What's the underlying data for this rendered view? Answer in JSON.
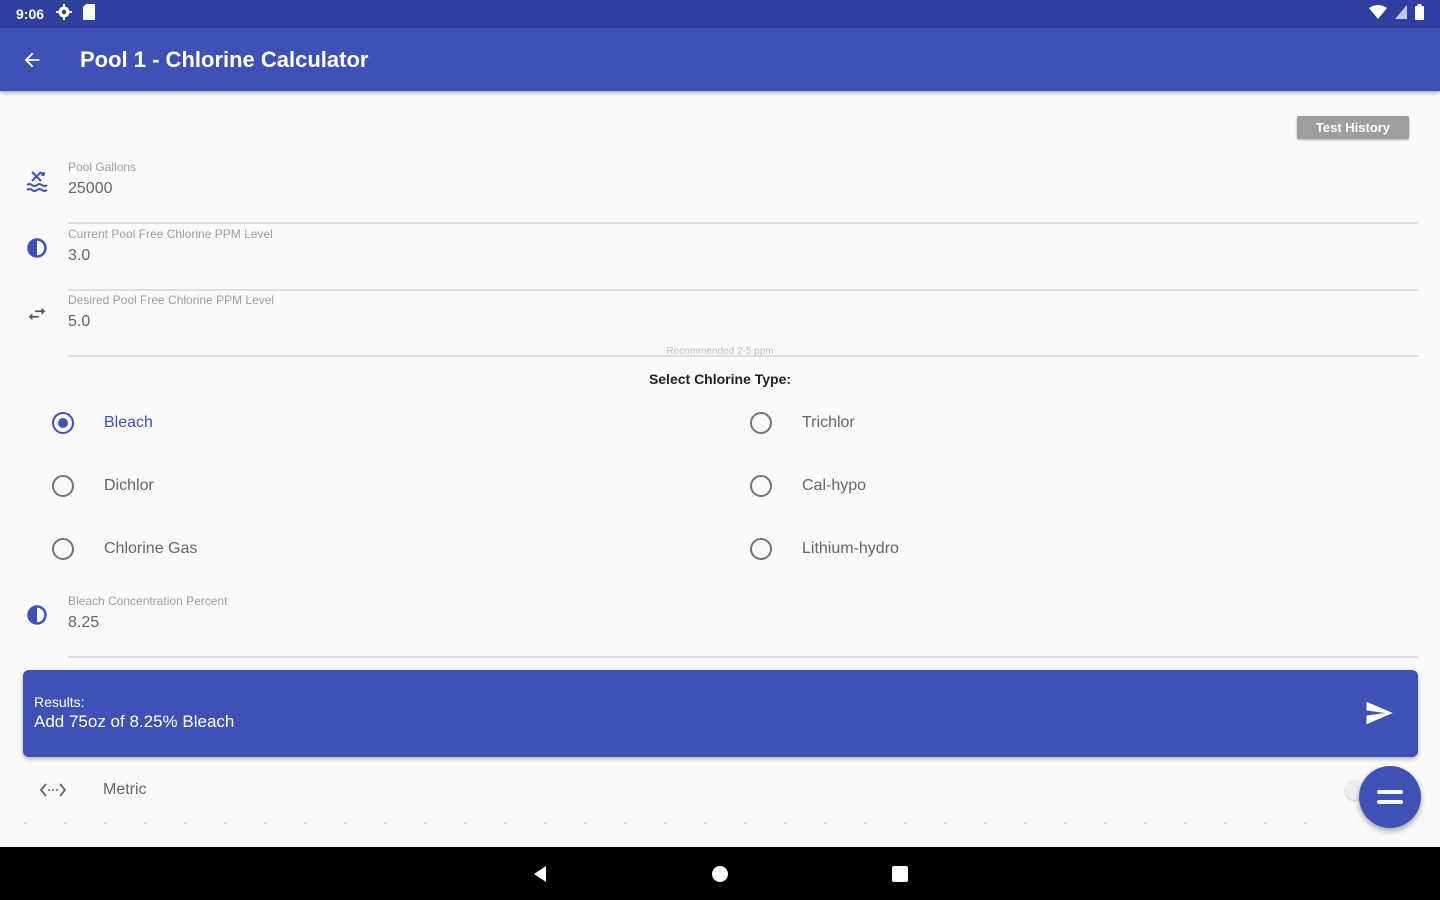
{
  "status_bar": {
    "time": "9:06"
  },
  "app_bar": {
    "title": "Pool 1 - Chlorine Calculator"
  },
  "test_history_label": "Test History",
  "fields": {
    "pool_gallons": {
      "label": "Pool Gallons",
      "value": "25000"
    },
    "current_ppm": {
      "label": "Current Pool Free Chlorine PPM Level",
      "value": "3.0"
    },
    "desired_ppm": {
      "label": "Desired Pool Free Chlorine PPM Level",
      "value": "5.0"
    },
    "bleach_percent": {
      "label": "Bleach Concentration Percent",
      "value": "8.25"
    }
  },
  "recommended_hint": "Recommended 2-5 ppm",
  "select_type_title": "Select Chlorine Type:",
  "chlorine_types": {
    "bleach": {
      "label": "Bleach",
      "checked": true
    },
    "trichlor": {
      "label": "Trichlor",
      "checked": false
    },
    "dichlor": {
      "label": "Dichlor",
      "checked": false
    },
    "cal_hypo": {
      "label": "Cal-hypo",
      "checked": false
    },
    "chlorine_gas": {
      "label": "Chlorine Gas",
      "checked": false
    },
    "lithium_hydro": {
      "label": "Lithium-hydro",
      "checked": false
    }
  },
  "results": {
    "heading": "Results:",
    "text": "Add 75oz of 8.25% Bleach"
  },
  "metric_label": "Metric",
  "colors": {
    "primary": "#3f51b5",
    "primary_dark": "#303f9f",
    "background": "#fafafa"
  },
  "icons": {
    "status_left": [
      "settings-icon",
      "sd-card-icon"
    ],
    "status_right": [
      "wifi-icon",
      "signal-icon",
      "battery-icon"
    ],
    "fields": [
      "pool-icon",
      "contrast-icon",
      "swap-icon",
      "contrast-icon"
    ],
    "nav": [
      "back-triangle-icon",
      "home-circle-icon",
      "recents-square-icon"
    ]
  }
}
